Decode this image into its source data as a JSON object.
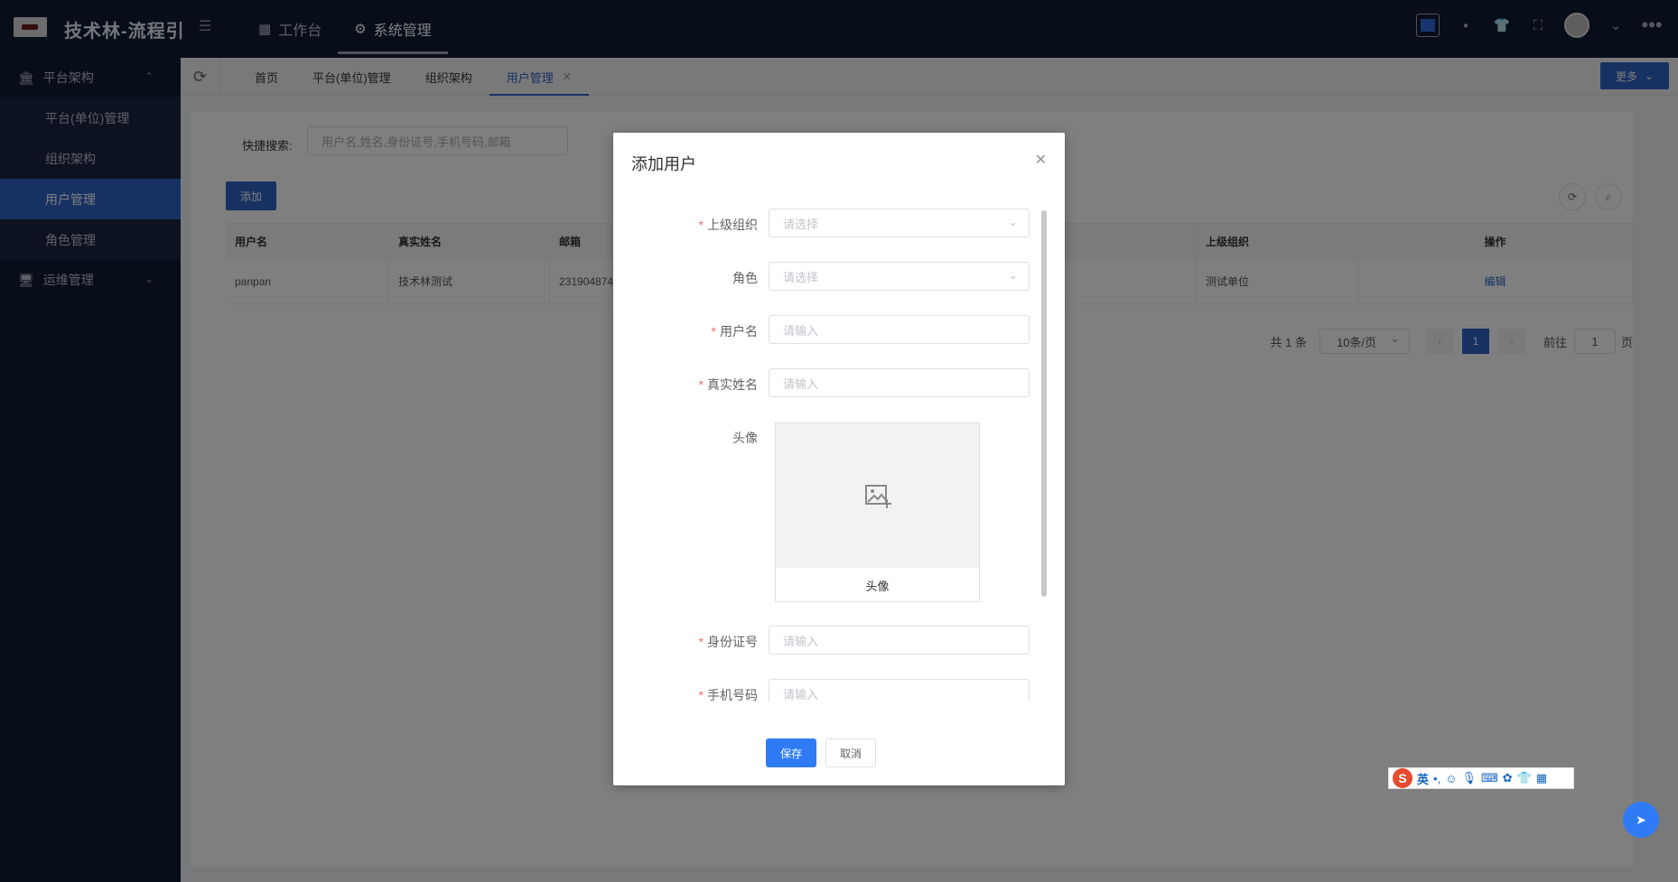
{
  "app": {
    "title": "技术林-流程引"
  },
  "topnav": [
    {
      "label": "工作台",
      "icon": "dashboard-icon"
    },
    {
      "label": "系统管理",
      "icon": "gear-icon"
    }
  ],
  "sidebar": {
    "groups": [
      {
        "label": "平台架构",
        "icon": "bank-icon",
        "expanded": true,
        "items": [
          {
            "label": "平台(单位)管理"
          },
          {
            "label": "组织架构"
          },
          {
            "label": "用户管理",
            "active": true
          },
          {
            "label": "角色管理"
          }
        ]
      },
      {
        "label": "运维管理",
        "icon": "monitor-icon",
        "expanded": false
      }
    ]
  },
  "tabs": [
    {
      "label": "首页"
    },
    {
      "label": "平台(单位)管理"
    },
    {
      "label": "组织架构"
    },
    {
      "label": "用户管理",
      "active": true,
      "closable": true
    }
  ],
  "more_label": "更多",
  "search": {
    "label": "快捷搜索:",
    "placeholder": "用户名,姓名,身份证号,手机号码,邮箱"
  },
  "add_label": "添加",
  "table": {
    "headers": [
      "用户名",
      "真实姓名",
      "邮箱",
      "",
      "上级组织",
      "操作"
    ],
    "rows": [
      {
        "username": "panpan",
        "realname": "技术林测试",
        "email": "231904874",
        "col4": "",
        "org": "测试单位",
        "action": "编辑"
      }
    ]
  },
  "pagination": {
    "total": "共 1 条",
    "page_size": "10条/页",
    "current": "1",
    "goto_prefix": "前往",
    "goto_value": "1",
    "goto_suffix": "页"
  },
  "modal": {
    "title": "添加用户",
    "fields": [
      {
        "label": "上级组织",
        "required": true,
        "placeholder": "请选择",
        "type": "select"
      },
      {
        "label": "角色",
        "required": false,
        "placeholder": "请选择",
        "type": "select"
      },
      {
        "label": "用户名",
        "required": true,
        "placeholder": "请输入",
        "type": "input"
      },
      {
        "label": "真实姓名",
        "required": true,
        "placeholder": "请输入",
        "type": "input"
      },
      {
        "label": "头像",
        "required": false,
        "caption": "头像",
        "type": "upload"
      },
      {
        "label": "身份证号",
        "required": true,
        "placeholder": "请输入",
        "type": "input"
      },
      {
        "label": "手机号码",
        "required": true,
        "placeholder": "请输入",
        "type": "input"
      }
    ],
    "save_label": "保存",
    "cancel_label": "取消"
  },
  "ime": {
    "lang": "英"
  },
  "colors": {
    "primary": "#2f63c5",
    "topbar": "#0f1a33",
    "required": "#f56c6c"
  }
}
